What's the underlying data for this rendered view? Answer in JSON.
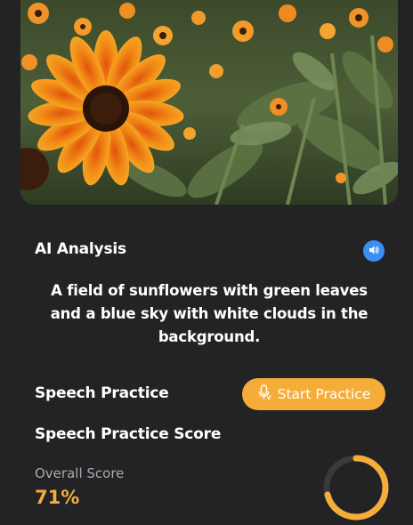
{
  "analysis": {
    "title": "AI Analysis",
    "description": " A field of sunflowers with green leaves and a blue sky with white clouds in the background."
  },
  "practice": {
    "title": "Speech Practice",
    "start_button_label": "Start Practice"
  },
  "score": {
    "title": "Speech Practice Score",
    "overall_label": "Overall Score",
    "overall_value": "71%",
    "progress_fraction": 0.71
  },
  "icons": {
    "speaker": "speaker-icon",
    "microphone": "microphone-icon"
  },
  "colors": {
    "background": "#232325",
    "accent": "#f5ad3a",
    "speaker_button": "#3d8ef4",
    "ring_track": "#3a3a3d",
    "muted_text": "#a9a9ad"
  }
}
